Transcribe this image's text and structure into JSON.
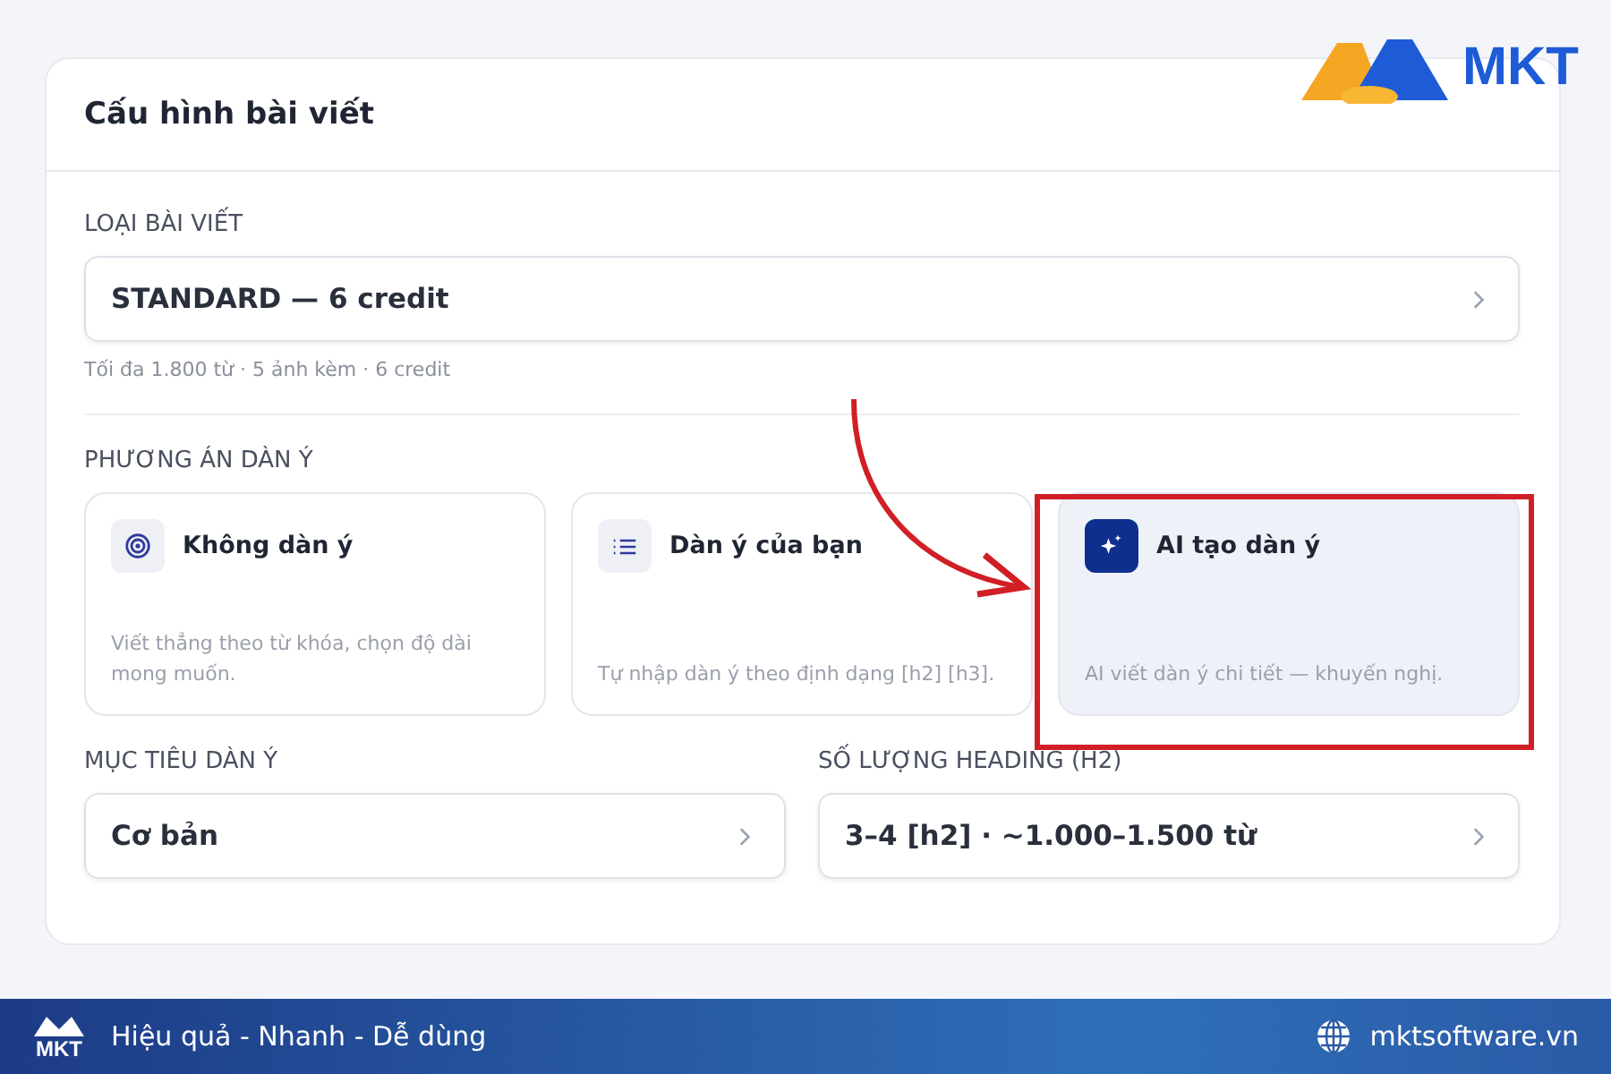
{
  "logo": {
    "text": "MKT"
  },
  "card": {
    "title": "Cấu hình bài viết"
  },
  "article_type": {
    "label": "LOẠI BÀI VIẾT",
    "value": "STANDARD — 6 credit",
    "hint": "Tối đa 1.800 từ · 5 ảnh kèm · 6 credit"
  },
  "outline_options": {
    "label": "PHƯƠNG ÁN DÀN Ý",
    "items": [
      {
        "kind": "target",
        "title": "Không dàn ý",
        "description": "Viết thẳng theo từ khóa, chọn độ dài mong muốn.",
        "selected": false
      },
      {
        "kind": "list",
        "title": "Dàn ý của bạn",
        "description": "Tự nhập dàn ý theo định dạng [h2] [h3].",
        "selected": false
      },
      {
        "kind": "sparkle",
        "title": "AI tạo dàn ý",
        "description": "AI viết dàn ý chi tiết — khuyến nghị.",
        "selected": true
      }
    ]
  },
  "selects": [
    {
      "label": "MỤC TIÊU DÀN Ý",
      "value": "Cơ bản"
    },
    {
      "label": "SỐ LƯỢNG HEADING (H2)",
      "value": "3–4 [h2] · ~1.000–1.500 từ"
    }
  ],
  "footer": {
    "logo": "MKT",
    "slogan": "Hiệu quả - Nhanh - Dễ dùng",
    "website": "mktsoftware.vn"
  }
}
